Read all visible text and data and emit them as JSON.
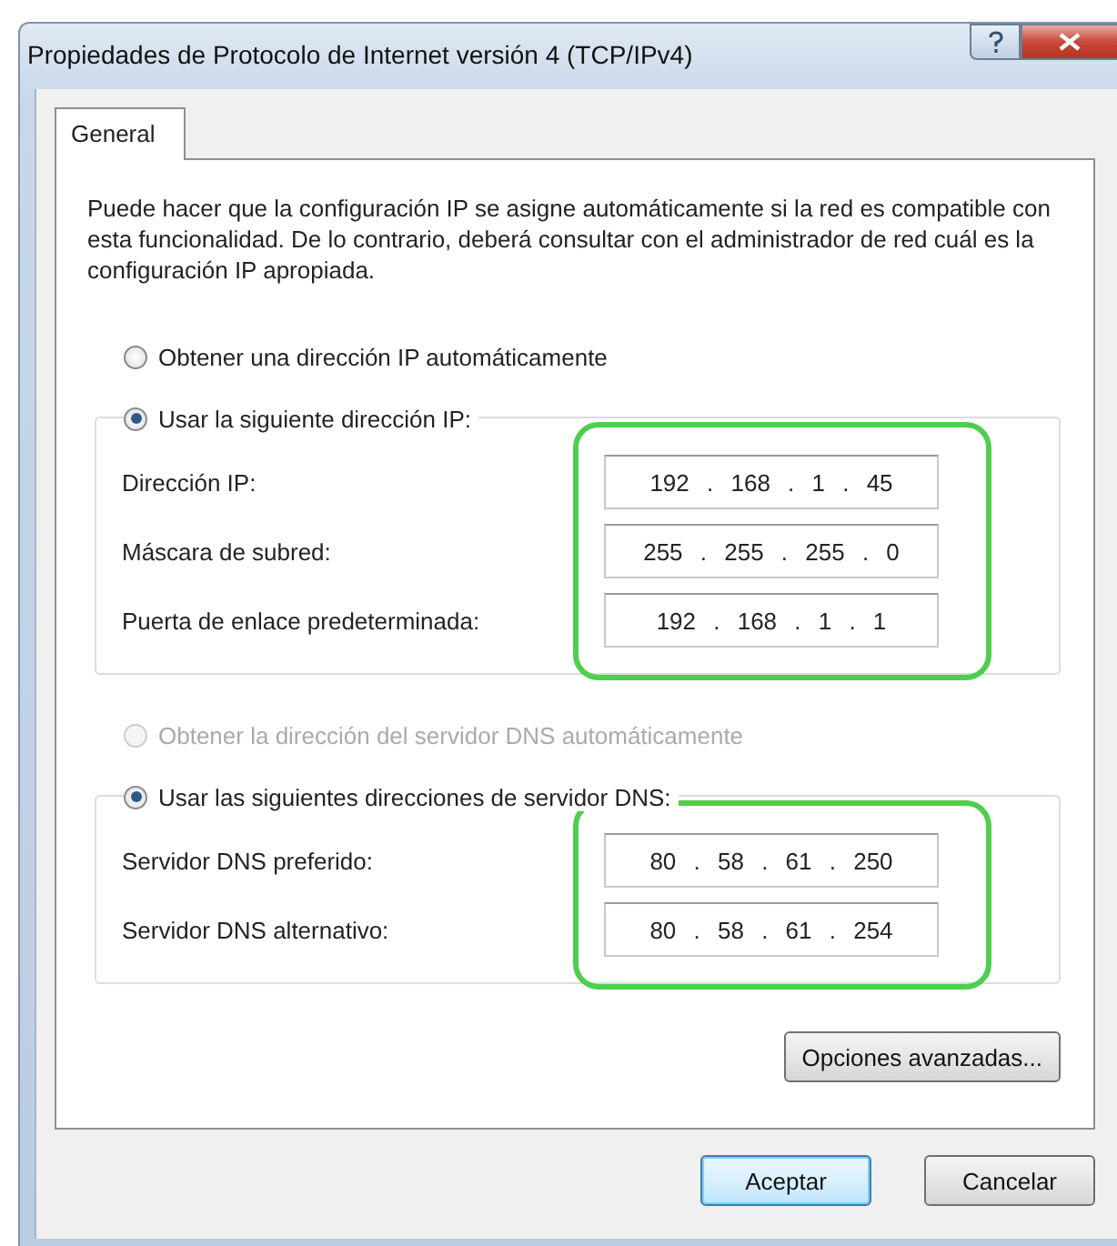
{
  "window": {
    "title": "Propiedades de Protocolo de Internet versión 4 (TCP/IPv4)"
  },
  "tabs": [
    {
      "label": "General",
      "selected": true
    }
  ],
  "description": "Puede hacer que la configuración IP se asigne automáticamente si la red es compatible con esta funcionalidad. De lo contrario, deberá consultar con el administrador de red cuál es la configuración IP apropiada.",
  "ip_section": {
    "options": [
      {
        "label": "Obtener una dirección IP automáticamente",
        "selected": false,
        "disabled": false
      },
      {
        "label": "Usar la siguiente dirección IP:",
        "selected": true,
        "disabled": false
      }
    ],
    "highlighted": true,
    "fields": [
      {
        "label": "Dirección IP:",
        "value": "192 . 168 . 1 . 45"
      },
      {
        "label": "Máscara de subred:",
        "value": "255 . 255 . 255 . 0"
      },
      {
        "label": "Puerta de enlace predeterminada:",
        "value": "192 . 168 . 1 . 1"
      }
    ]
  },
  "dns_section": {
    "options": [
      {
        "label": "Obtener la dirección del servidor DNS automáticamente",
        "selected": false,
        "disabled": true
      },
      {
        "label": "Usar las siguientes direcciones de servidor DNS:",
        "selected": true,
        "disabled": false
      }
    ],
    "highlighted": true,
    "fields": [
      {
        "label": "Servidor DNS preferido:",
        "value": "80 . 58 . 61 . 250"
      },
      {
        "label": "Servidor DNS alternativo:",
        "value": "80 . 58 . 61 . 254"
      }
    ]
  },
  "advanced_button": "Opciones avanzadas...",
  "buttons": [
    {
      "label": "Aceptar",
      "default": true
    },
    {
      "label": "Cancelar",
      "default": false
    }
  ]
}
